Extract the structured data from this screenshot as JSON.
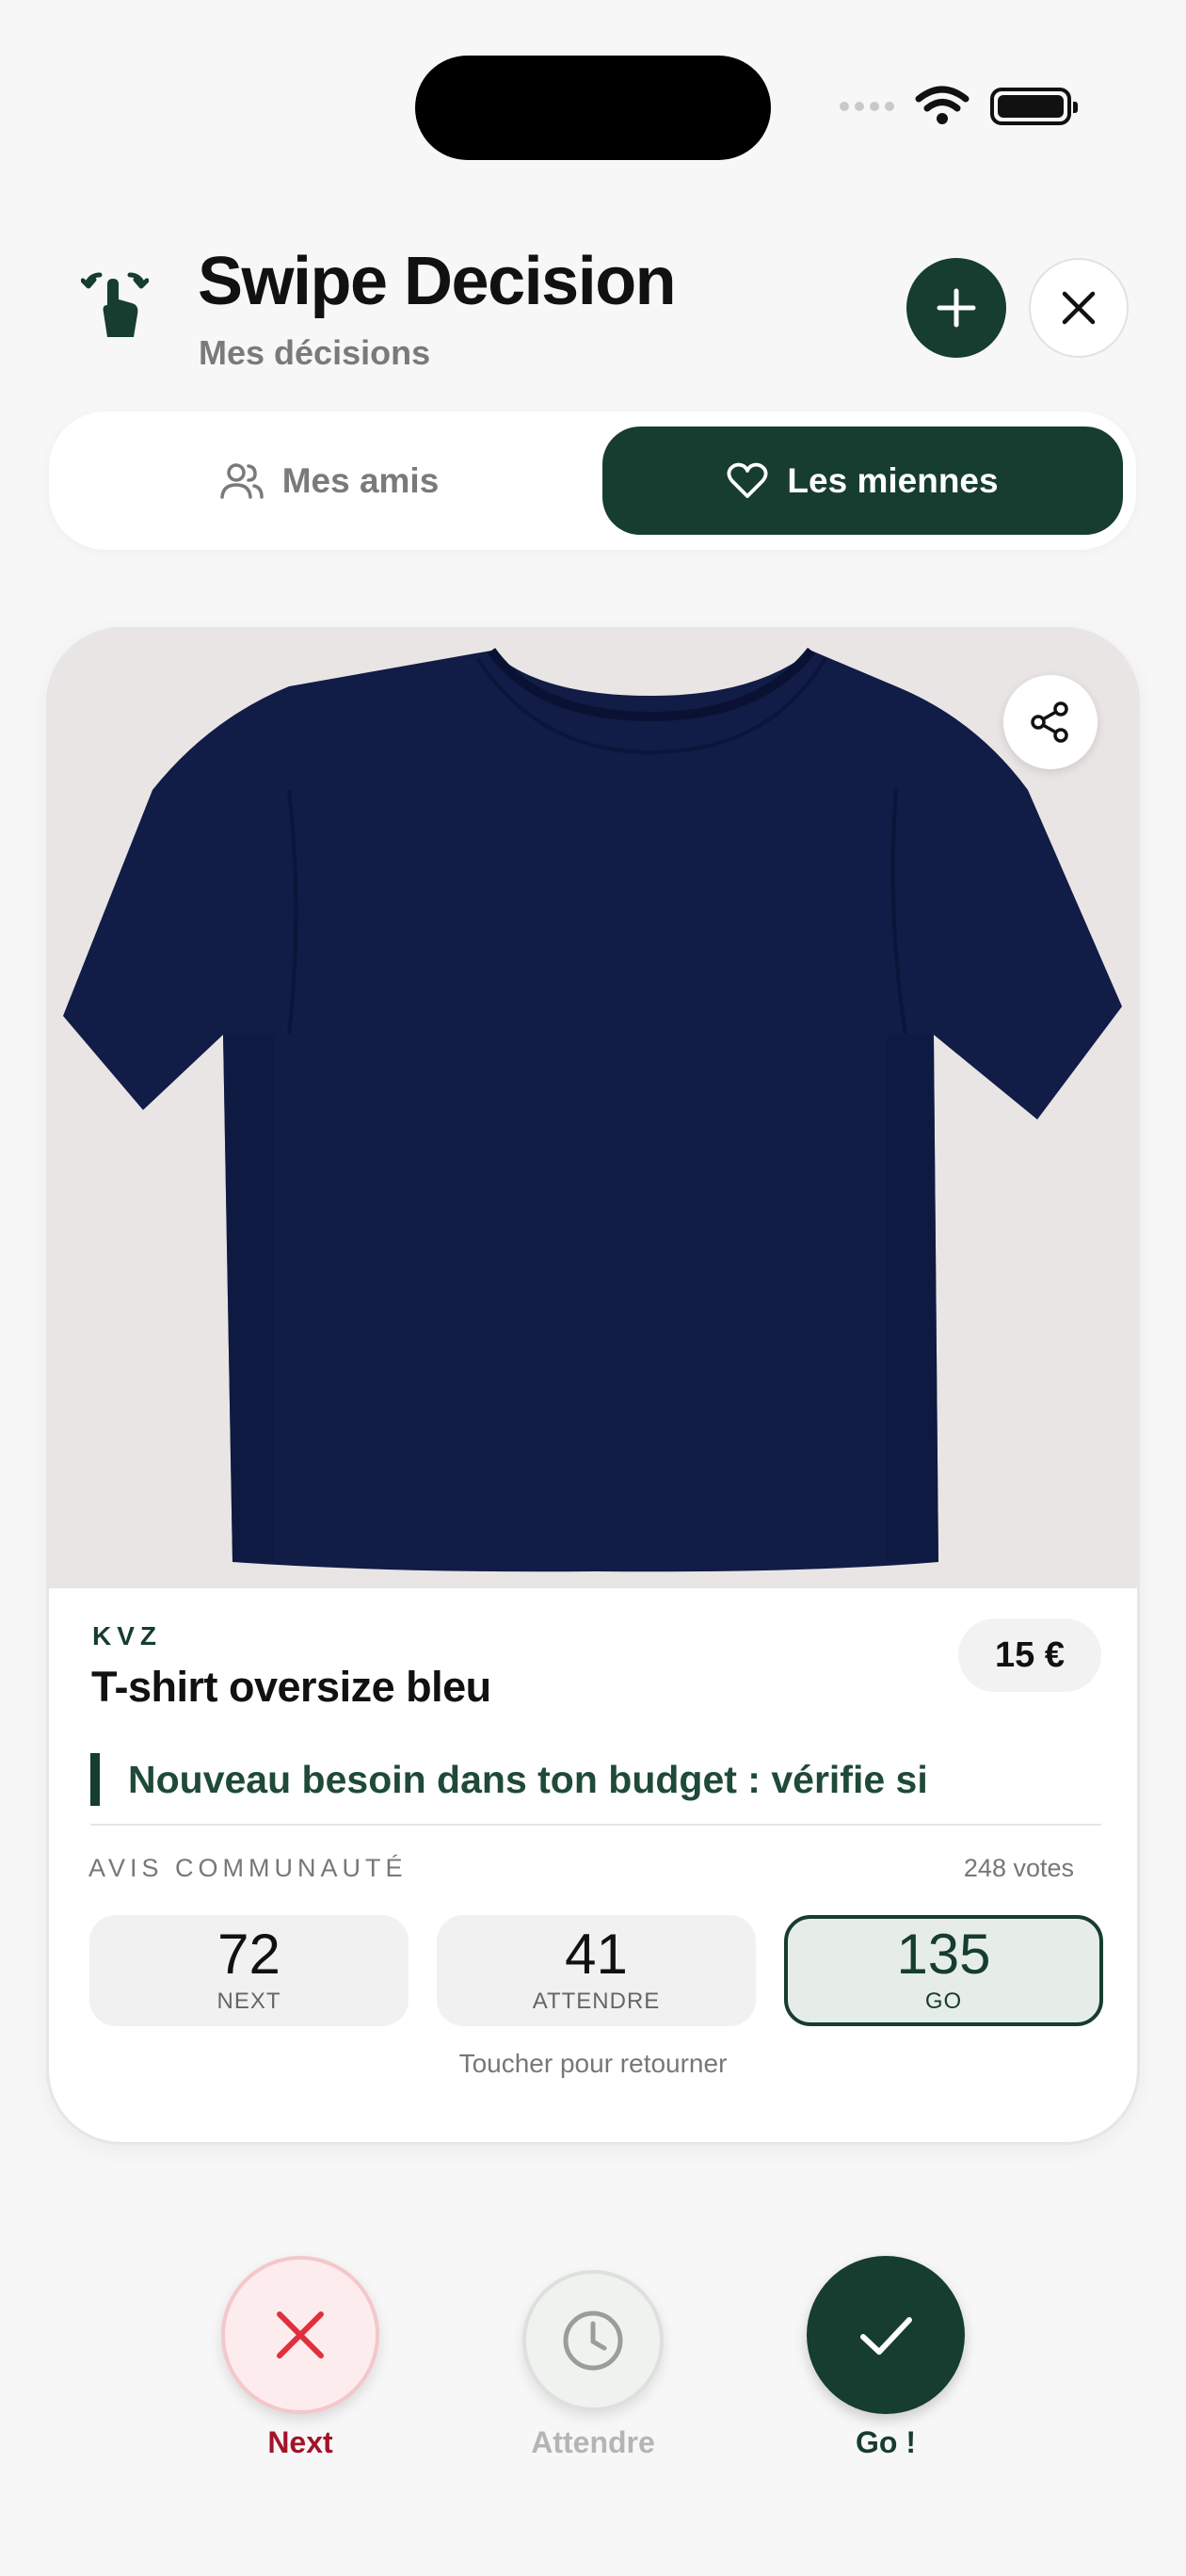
{
  "header": {
    "title": "Swipe Decision",
    "subtitle": "Mes décisions"
  },
  "tabs": [
    {
      "label": "Mes amis",
      "icon": "users-icon",
      "active": false
    },
    {
      "label": "Les miennes",
      "icon": "heart-icon",
      "active": true
    }
  ],
  "product": {
    "brand": "KVZ",
    "name": "T-shirt oversize bleu",
    "price": "15 €",
    "advice": "Nouveau besoin dans ton budget : vérifie si",
    "image": "navy-tshirt"
  },
  "community": {
    "label": "AVIS COMMUNAUTÉ",
    "votes_text": "248 votes",
    "next": {
      "count": "72",
      "label": "NEXT"
    },
    "wait": {
      "count": "41",
      "label": "ATTENDRE"
    },
    "go": {
      "count": "135",
      "label": "GO"
    },
    "flip_hint": "Toucher pour retourner"
  },
  "actions": {
    "next_label": "Next",
    "wait_label": "Attendre",
    "go_label": "Go !"
  },
  "colors": {
    "accent": "#163d2f",
    "next_red": "#a2132a",
    "background": "#f7f7f7"
  }
}
